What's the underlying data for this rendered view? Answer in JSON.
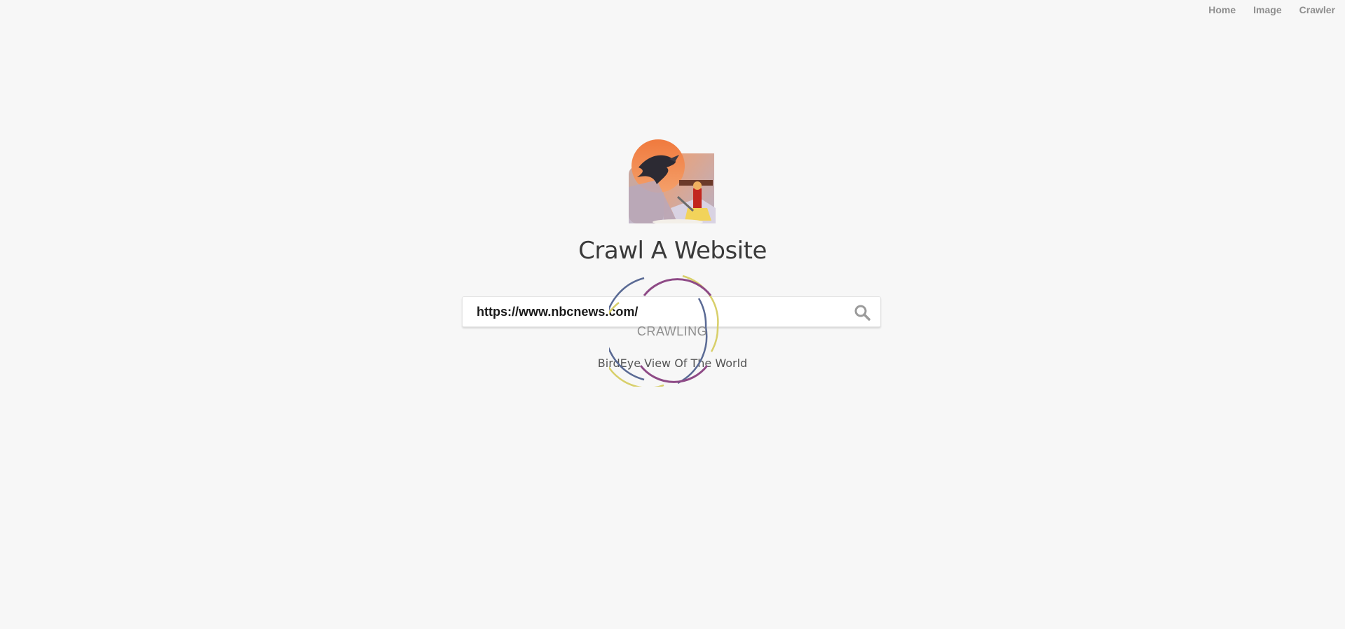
{
  "nav": {
    "items": [
      {
        "label": "Home"
      },
      {
        "label": "Image"
      },
      {
        "label": "Crawler"
      }
    ]
  },
  "page": {
    "title": "Crawl A Website",
    "subtitle": "BirdEye View Of The World"
  },
  "search": {
    "value": "https://www.nbcnews.com/",
    "icon": "search-icon"
  },
  "loader": {
    "label": "CRAWLING",
    "colors": {
      "outer": "#5a6a94",
      "middle": "#d8cf6a",
      "inner": "#8e4a86"
    }
  },
  "colors": {
    "background": "#f7f7f7",
    "title": "#3a3a3a",
    "nav": "#8e8e8e"
  }
}
